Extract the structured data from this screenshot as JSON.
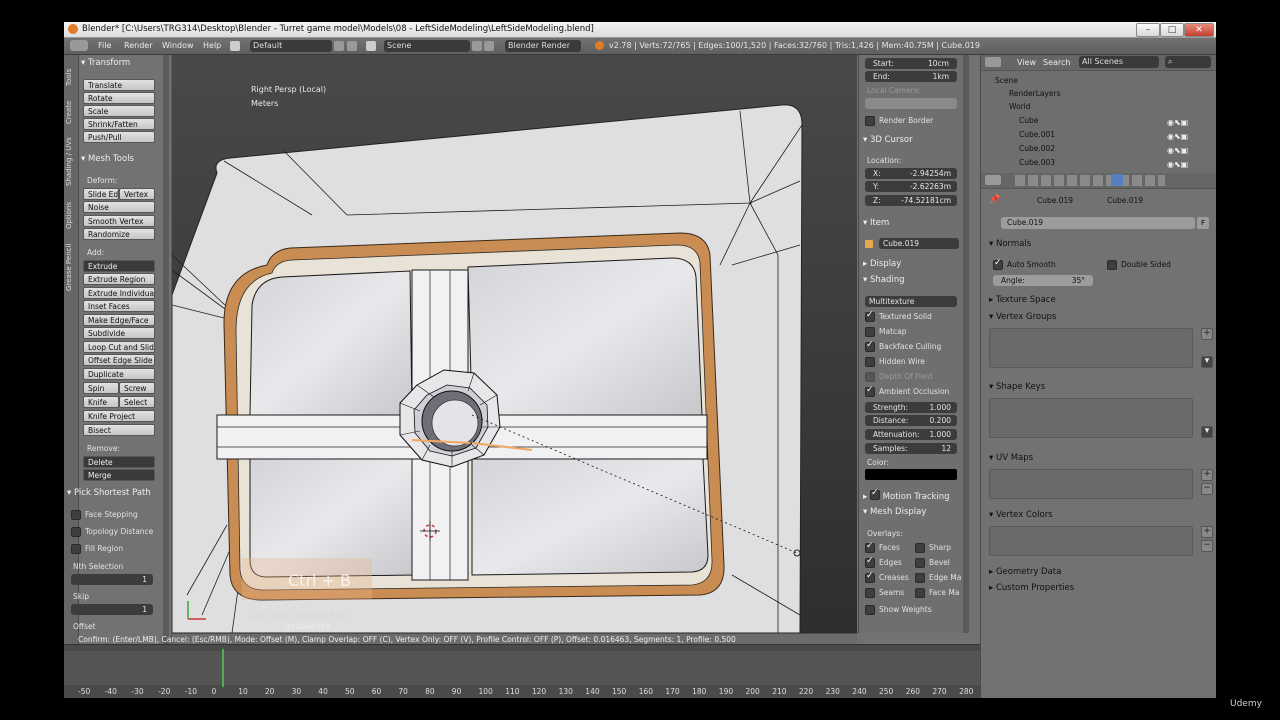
{
  "window": {
    "title": "Blender* [C:\\Users\\TRG314\\Desktop\\Blender - Turret game model\\Models\\08 - LeftSideModeling\\LeftSideModeling.blend]"
  },
  "infobar": {
    "menus": [
      "File",
      "Render",
      "Window",
      "Help"
    ],
    "layout": "Default",
    "scene": "Scene",
    "engine": "Blender Render",
    "stats": "v2.78 | Verts:72/765 | Edges:100/1,520 | Faces:32/760 | Tris:1,426 | Mem:40.75M | Cube.019"
  },
  "vtabs": [
    "Tools",
    "Create",
    "Shading / UVs",
    "Options",
    "Grease Pencil"
  ],
  "tools": {
    "transform": {
      "header": "Transform",
      "buttons": [
        "Translate",
        "Rotate",
        "Scale",
        "Shrink/Fatten",
        "Push/Pull"
      ]
    },
    "mesh_tools": {
      "header": "Mesh Tools",
      "deform_label": "Deform:",
      "slide_edge": "Slide Ed",
      "vertex": "Vertex",
      "noise": "Noise",
      "smooth_vertex": "Smooth Vertex",
      "randomize": "Randomize",
      "add_label": "Add:",
      "extrude": "Extrude",
      "add_buttons": [
        "Extrude Region",
        "Extrude Individual",
        "Inset Faces",
        "Make Edge/Face",
        "Subdivide",
        "Loop Cut and Slide",
        "Offset Edge Slide",
        "Duplicate"
      ],
      "spin": "Spin",
      "screw": "Screw",
      "knife": "Knife",
      "select": "Select",
      "knife_project": "Knife Project",
      "bisect": "Bisect",
      "remove_label": "Remove:",
      "delete": "Delete",
      "merge": "Merge"
    },
    "pick_shortest_path": {
      "header": "Pick Shortest Path",
      "face_stepping": "Face Stepping",
      "topology_distance": "Topology Distance",
      "fill_region": "Fill Region",
      "nth_selection": "Nth Selection",
      "nth_value": "1",
      "skip": "Skip",
      "skip_value": "1",
      "offset": "Offset"
    }
  },
  "viewport": {
    "view_name": "Right Persp (Local)",
    "units": "Meters",
    "key_overlay": "Ctrl + B",
    "last_op": "Last: Pick Shortest Path",
    "object_label": "(1) Cube.019"
  },
  "npanel": {
    "clip_start_label": "Start:",
    "clip_start": "10cm",
    "clip_end_label": "End:",
    "clip_end": "1km",
    "local_camera": "Local Camera:",
    "render_border": "Render Border",
    "cursor_header": "3D Cursor",
    "location": "Location:",
    "x_label": "X:",
    "x": "-2.94254m",
    "y_label": "Y:",
    "y": "-2.62263m",
    "z_label": "Z:",
    "z": "-74.52181cm",
    "item_header": "Item",
    "item_name": "Cube.019",
    "display_header": "Display",
    "shading_header": "Shading",
    "shading_mode": "Multitexture",
    "textured_solid": "Textured Solid",
    "matcap": "Matcap",
    "backface_culling": "Backface Culling",
    "hidden_wire": "Hidden Wire",
    "depth_of_field": "Depth Of Field",
    "ambient_occlusion": "Ambient Occlusion",
    "strength_label": "Strength:",
    "strength": "1.000",
    "distance_label": "Distance:",
    "distance": "0.200",
    "attenuation_label": "Attenuation:",
    "attenuation": "1.000",
    "samples_label": "Samples:",
    "samples": "12",
    "color_label": "Color:",
    "motion_tracking": "Motion Tracking",
    "mesh_display_header": "Mesh Display",
    "overlays": "Overlays:",
    "faces": "Faces",
    "sharp": "Sharp",
    "edges": "Edges",
    "bevel": "Bevel",
    "creases": "Creases",
    "edge_marks": "Edge Ma",
    "seams": "Seams",
    "face_marks": "Face Ma",
    "show_weights": "Show Weights"
  },
  "outliner": {
    "view": "View",
    "search": "Search",
    "filter": "All Scenes",
    "items": [
      "Scene",
      "RenderLayers",
      "World",
      "Cube",
      "Cube.001",
      "Cube.002",
      "Cube.003"
    ]
  },
  "properties": {
    "crumb_object": "Cube.019",
    "crumb_mesh": "Cube.019",
    "datablock": "Cube.019",
    "fake_user": "F",
    "normals_header": "Normals",
    "auto_smooth": "Auto Smooth",
    "double_sided": "Double Sided",
    "angle_label": "Angle:",
    "angle": "35°",
    "sections": [
      "Texture Space",
      "Vertex Groups",
      "Shape Keys",
      "UV Maps",
      "Vertex Colors",
      "Geometry Data",
      "Custom Properties"
    ]
  },
  "status": {
    "text": "Confirm: (Enter/LMB), Cancel: (Esc/RMB), Mode: Offset (M), Clamp Overlap: OFF (C), Vertex Only: OFF (V), Profile Control: OFF (P), Offset: 0.016463, Segments: 1, Profile: 0.500"
  },
  "timeline": {
    "ticks": [
      "-50",
      "-40",
      "-30",
      "-20",
      "-10",
      "0",
      "10",
      "20",
      "30",
      "40",
      "50",
      "60",
      "70",
      "80",
      "90",
      "100",
      "110",
      "120",
      "130",
      "140",
      "150",
      "160",
      "170",
      "180",
      "190",
      "200",
      "210",
      "220",
      "230",
      "240",
      "250",
      "260",
      "270",
      "280"
    ]
  },
  "udemy": "Udemy",
  "colors": {
    "accent": "#e6a05c",
    "mesh_face": "#ececee",
    "frame": "#c2854a"
  }
}
